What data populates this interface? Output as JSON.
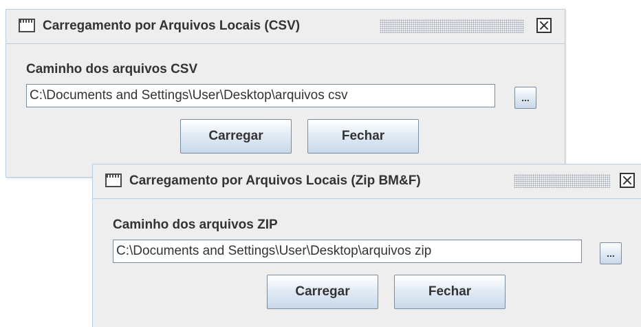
{
  "windows": [
    {
      "title": "Carregamento por Arquivos Locais (CSV)",
      "field_label": "Caminho dos arquivos CSV",
      "path_value": "C:\\Documents and Settings\\User\\Desktop\\arquivos csv",
      "browse_label": "...",
      "load_label": "Carregar",
      "close_label": "Fechar"
    },
    {
      "title": "Carregamento por Arquivos Locais (Zip BM&F)",
      "field_label": "Caminho dos arquivos ZIP",
      "path_value": "C:\\Documents and Settings\\User\\Desktop\\arquivos zip",
      "browse_label": "...",
      "load_label": "Carregar",
      "close_label": "Fechar"
    }
  ],
  "colors": {
    "window_background": "#eeeeee",
    "window_border": "#b8cfe5",
    "text": "#333333",
    "button_gradient_bottom": "#c9d9ea"
  },
  "icons": {
    "title_icon": "window-icon",
    "close_icon": "close-x-icon"
  }
}
